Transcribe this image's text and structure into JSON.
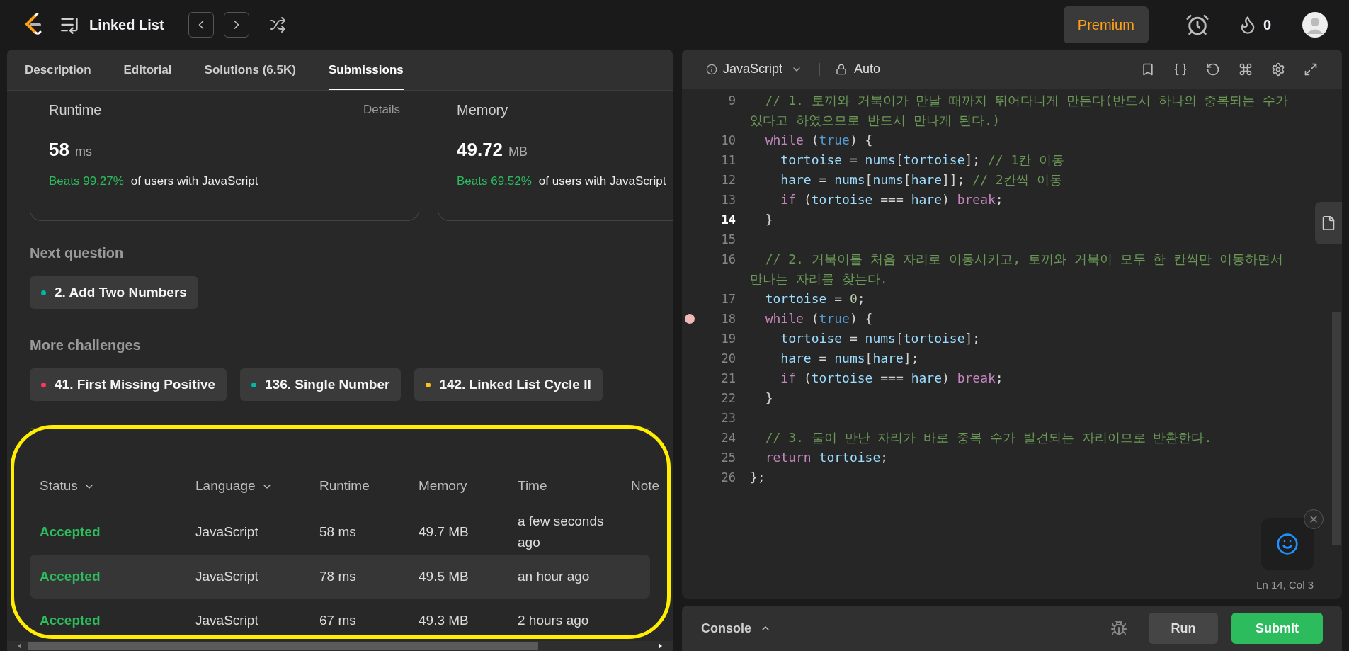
{
  "top_bar": {
    "problem_title": "Linked List",
    "premium": "Premium",
    "streak": "0"
  },
  "left_panel": {
    "tabs": [
      {
        "label": "Description",
        "selected": false
      },
      {
        "label": "Editorial",
        "selected": false
      },
      {
        "label": "Solutions (6.5K)",
        "selected": false
      },
      {
        "label": "Submissions",
        "selected": true
      }
    ],
    "stats": [
      {
        "label": "Runtime",
        "link": "Details",
        "value": "58",
        "unit": "ms",
        "beats": "Beats 99.27%",
        "beats_text": "of users with JavaScript"
      },
      {
        "label": "Memory",
        "value": "49.72",
        "unit": "MB",
        "beats": "Beats 69.52%",
        "beats_text": "of users with JavaScript"
      }
    ],
    "next_question": {
      "heading": "Next question",
      "items": [
        {
          "title": "2. Add Two Numbers",
          "color": "#00b8a3"
        }
      ]
    },
    "more_challenges": {
      "heading": "More challenges",
      "items": [
        {
          "title": "41. First Missing Positive",
          "color": "#ff375f"
        },
        {
          "title": "136. Single Number",
          "color": "#00b8a3"
        },
        {
          "title": "142. Linked List Cycle II",
          "color": "#ffc01e"
        }
      ]
    },
    "table": {
      "columns": [
        {
          "label": "Status",
          "sortable": true
        },
        {
          "label": "Language",
          "sortable": true
        },
        {
          "label": "Runtime",
          "sortable": false
        },
        {
          "label": "Memory",
          "sortable": false
        },
        {
          "label": "Time",
          "sortable": false
        },
        {
          "label": "Note",
          "sortable": false
        }
      ],
      "rows": [
        {
          "status": "Accepted",
          "language": "JavaScript",
          "runtime": "58 ms",
          "memory": "49.7 MB",
          "time": "a few seconds ago",
          "selected": false
        },
        {
          "status": "Accepted",
          "language": "JavaScript",
          "runtime": "78 ms",
          "memory": "49.5 MB",
          "time": "an hour ago",
          "selected": true
        },
        {
          "status": "Accepted",
          "language": "JavaScript",
          "runtime": "67 ms",
          "memory": "49.3 MB",
          "time": "2 hours ago",
          "selected": false
        }
      ]
    }
  },
  "editor": {
    "language": "JavaScript",
    "mode": "Auto",
    "lines": [
      {
        "number": "9",
        "current": false,
        "breakpoint": false,
        "tokens": [
          {
            "kind": "comment",
            "text": "  // 1. 토끼와 거북이가 만날 때까지 뛰어다니게 만든다(반드시 하나의 중복되는 수가 있다고 하였으므로 반드시 만나게 된다.)"
          }
        ]
      },
      {
        "number": "10",
        "current": false,
        "breakpoint": false,
        "tokens": [
          {
            "kind": "keyword",
            "text": "  while"
          },
          {
            "kind": "plain",
            "text": " ("
          },
          {
            "kind": "literal",
            "text": "true"
          },
          {
            "kind": "plain",
            "text": ") {"
          }
        ]
      },
      {
        "number": "11",
        "current": false,
        "breakpoint": false,
        "tokens": [
          {
            "kind": "variable",
            "text": "    tortoise"
          },
          {
            "kind": "plain",
            "text": " = "
          },
          {
            "kind": "variable",
            "text": "nums"
          },
          {
            "kind": "plain",
            "text": "["
          },
          {
            "kind": "variable",
            "text": "tortoise"
          },
          {
            "kind": "plain",
            "text": "]; "
          },
          {
            "kind": "comment",
            "text": "// 1칸 이동"
          }
        ]
      },
      {
        "number": "12",
        "current": false,
        "breakpoint": false,
        "tokens": [
          {
            "kind": "variable",
            "text": "    hare"
          },
          {
            "kind": "plain",
            "text": " = "
          },
          {
            "kind": "variable",
            "text": "nums"
          },
          {
            "kind": "plain",
            "text": "["
          },
          {
            "kind": "variable",
            "text": "nums"
          },
          {
            "kind": "plain",
            "text": "["
          },
          {
            "kind": "variable",
            "text": "hare"
          },
          {
            "kind": "plain",
            "text": "]]; "
          },
          {
            "kind": "comment",
            "text": "// 2칸씩 이동"
          }
        ]
      },
      {
        "number": "13",
        "current": false,
        "breakpoint": false,
        "tokens": [
          {
            "kind": "keyword",
            "text": "    if"
          },
          {
            "kind": "plain",
            "text": " ("
          },
          {
            "kind": "variable",
            "text": "tortoise"
          },
          {
            "kind": "plain",
            "text": " === "
          },
          {
            "kind": "variable",
            "text": "hare"
          },
          {
            "kind": "plain",
            "text": ") "
          },
          {
            "kind": "keyword",
            "text": "break"
          },
          {
            "kind": "plain",
            "text": ";"
          }
        ]
      },
      {
        "number": "14",
        "current": true,
        "breakpoint": false,
        "tokens": [
          {
            "kind": "plain",
            "text": "  }"
          }
        ]
      },
      {
        "number": "15",
        "current": false,
        "breakpoint": false
      },
      {
        "number": "16",
        "current": false,
        "breakpoint": false,
        "tokens": [
          {
            "kind": "comment",
            "text": "  // 2. 거북이를 처음 자리로 이동시키고, 토끼와 거북이 모두 한 칸씩만 이동하면서 만나는 자리를 찾는다."
          }
        ]
      },
      {
        "number": "17",
        "current": false,
        "breakpoint": false,
        "tokens": [
          {
            "kind": "variable",
            "text": "  tortoise"
          },
          {
            "kind": "plain",
            "text": " = "
          },
          {
            "kind": "number",
            "text": "0"
          },
          {
            "kind": "plain",
            "text": ";"
          }
        ]
      },
      {
        "number": "18",
        "current": false,
        "breakpoint": true,
        "tokens": [
          {
            "kind": "keyword",
            "text": "  while"
          },
          {
            "kind": "plain",
            "text": " ("
          },
          {
            "kind": "literal",
            "text": "true"
          },
          {
            "kind": "plain",
            "text": ") {"
          }
        ]
      },
      {
        "number": "19",
        "current": false,
        "breakpoint": false,
        "tokens": [
          {
            "kind": "variable",
            "text": "    tortoise"
          },
          {
            "kind": "plain",
            "text": " = "
          },
          {
            "kind": "variable",
            "text": "nums"
          },
          {
            "kind": "plain",
            "text": "["
          },
          {
            "kind": "variable",
            "text": "tortoise"
          },
          {
            "kind": "plain",
            "text": "];"
          }
        ]
      },
      {
        "number": "20",
        "current": false,
        "breakpoint": false,
        "tokens": [
          {
            "kind": "variable",
            "text": "    hare"
          },
          {
            "kind": "plain",
            "text": " = "
          },
          {
            "kind": "variable",
            "text": "nums"
          },
          {
            "kind": "plain",
            "text": "["
          },
          {
            "kind": "variable",
            "text": "hare"
          },
          {
            "kind": "plain",
            "text": "];"
          }
        ]
      },
      {
        "number": "21",
        "current": false,
        "breakpoint": false,
        "tokens": [
          {
            "kind": "keyword",
            "text": "    if"
          },
          {
            "kind": "plain",
            "text": " ("
          },
          {
            "kind": "variable",
            "text": "tortoise"
          },
          {
            "kind": "plain",
            "text": " === "
          },
          {
            "kind": "variable",
            "text": "hare"
          },
          {
            "kind": "plain",
            "text": ") "
          },
          {
            "kind": "keyword",
            "text": "break"
          },
          {
            "kind": "plain",
            "text": ";"
          }
        ]
      },
      {
        "number": "22",
        "current": false,
        "breakpoint": false,
        "tokens": [
          {
            "kind": "plain",
            "text": "  }"
          }
        ]
      },
      {
        "number": "23",
        "current": false,
        "breakpoint": false
      },
      {
        "number": "24",
        "current": false,
        "breakpoint": false,
        "tokens": [
          {
            "kind": "comment",
            "text": "  // 3. 둘이 만난 자리가 바로 중복 수가 발견되는 자리이므로 반환한다."
          }
        ]
      },
      {
        "number": "25",
        "current": false,
        "breakpoint": false,
        "tokens": [
          {
            "kind": "keyword",
            "text": "  return "
          },
          {
            "kind": "variable",
            "text": "tortoise"
          },
          {
            "kind": "plain",
            "text": ";"
          }
        ]
      },
      {
        "number": "26",
        "current": false,
        "breakpoint": false,
        "tokens": [
          {
            "kind": "plain",
            "text": "};"
          }
        ]
      }
    ],
    "cursor": "Ln 14, Col 3"
  },
  "console": {
    "label": "Console",
    "run": "Run",
    "submit": "Submit"
  }
}
